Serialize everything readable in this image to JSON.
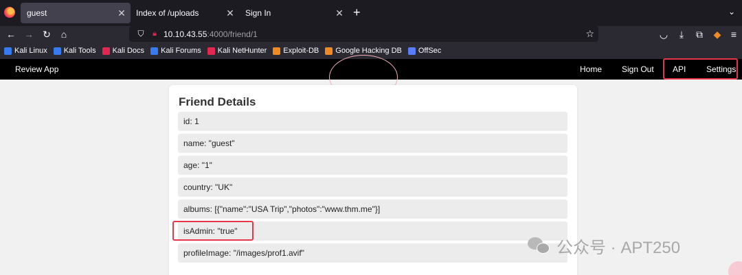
{
  "browser": {
    "tabs": [
      {
        "label": "guest"
      },
      {
        "label": "Index of /uploads"
      },
      {
        "label": "Sign In"
      }
    ],
    "new_tab": "+",
    "url": {
      "host": "10.10.43.55",
      "path": ":4000/friend/1"
    },
    "bookmarks": [
      {
        "label": "Kali Linux",
        "color": "#367bf0"
      },
      {
        "label": "Kali Tools",
        "color": "#367bf0"
      },
      {
        "label": "Kali Docs",
        "color": "#e22850"
      },
      {
        "label": "Kali Forums",
        "color": "#367bf0"
      },
      {
        "label": "Kali NetHunter",
        "color": "#e22850"
      },
      {
        "label": "Exploit-DB",
        "color": "#f08a24"
      },
      {
        "label": "Google Hacking DB",
        "color": "#f08a24"
      },
      {
        "label": "OffSec",
        "color": "#5b7cfa"
      }
    ]
  },
  "app": {
    "brand": "Review App",
    "nav": {
      "home": "Home",
      "signout": "Sign Out",
      "api": "API",
      "settings": "Settings"
    }
  },
  "card": {
    "title": "Friend Details",
    "rows": [
      "id: 1",
      "name: \"guest\"",
      "age: \"1\"",
      "country: \"UK\"",
      "albums: [{\"name\":\"USA Trip\",\"photos\":\"www.thm.me\"}]",
      "isAdmin: \"true\"",
      "profileImage: \"/images/prof1.avif\""
    ]
  },
  "watermark": "公众号 · APT250",
  "colors": {
    "highlight": "#e6364a",
    "appnav": "#000000"
  }
}
